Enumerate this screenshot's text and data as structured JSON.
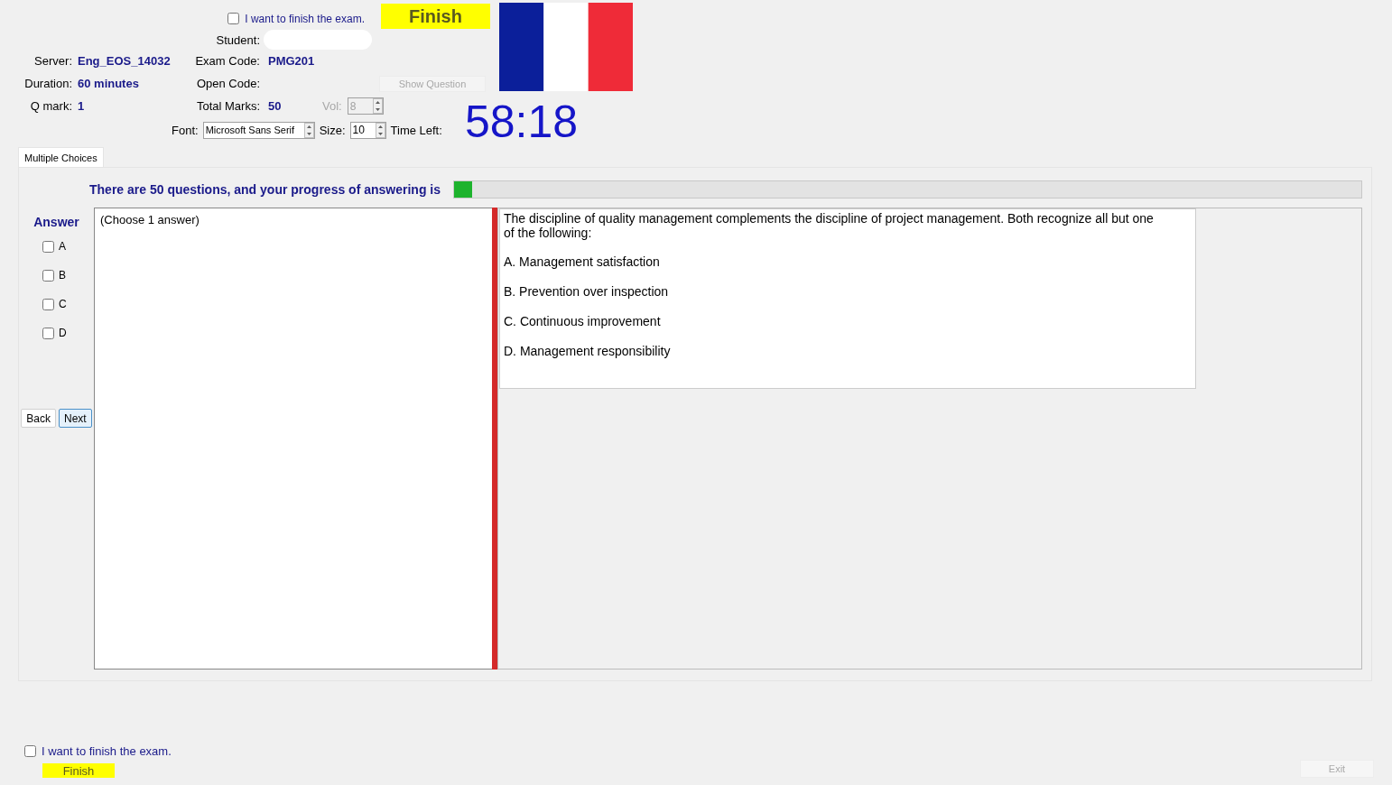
{
  "header": {
    "finish_check": {
      "label": "I want to finish the exam.",
      "checked": false
    },
    "finish_button": {
      "label": "Finish",
      "disabled": false
    },
    "student": {
      "label": "Student:"
    },
    "server": {
      "label": "Server:",
      "value": "Eng_EOS_14032"
    },
    "exam_code": {
      "label": "Exam Code:",
      "value": "PMG201"
    },
    "duration": {
      "label": "Duration:",
      "value": "60 minutes"
    },
    "open_code": {
      "label": "Open Code:"
    },
    "show_question": {
      "label": "Show Question",
      "disabled": true
    },
    "q_mark": {
      "label": "Q mark:",
      "value": "1"
    },
    "total_marks": {
      "label": "Total Marks:",
      "value": "50"
    },
    "vol": {
      "label": "Vol:",
      "value": "8",
      "disabled": true
    },
    "font": {
      "label": "Font:",
      "value": "Microsoft Sans Serif"
    },
    "size": {
      "label": "Size:",
      "value": "10"
    },
    "time_left": {
      "label": "Time Left:",
      "value": "58:18"
    }
  },
  "tabs": [
    {
      "label": "Multiple Choices",
      "selected": true
    }
  ],
  "progress": {
    "text": "There are 50 questions, and your progress of answering is",
    "level": 0.02
  },
  "answer": {
    "title": "Answer",
    "options": [
      {
        "label": "A",
        "checked": false
      },
      {
        "label": "B",
        "checked": false
      },
      {
        "label": "C",
        "checked": false
      },
      {
        "label": "D",
        "checked": false
      }
    ],
    "back": "Back",
    "next": "Next",
    "hint": "(Choose 1 answer)"
  },
  "question": {
    "text": "The discipline of quality management complements the discipline of project management. Both recognize all but one of the following:",
    "choices": [
      "A.  Management satisfaction",
      "B.  Prevention over inspection",
      "C.  Continuous improvement",
      "D.  Management responsibility"
    ]
  },
  "footer": {
    "finish_check": {
      "label": "I want to finish the exam.",
      "checked": false
    },
    "finish_button": "Finish",
    "exit": {
      "label": "Exit",
      "disabled": true
    }
  }
}
